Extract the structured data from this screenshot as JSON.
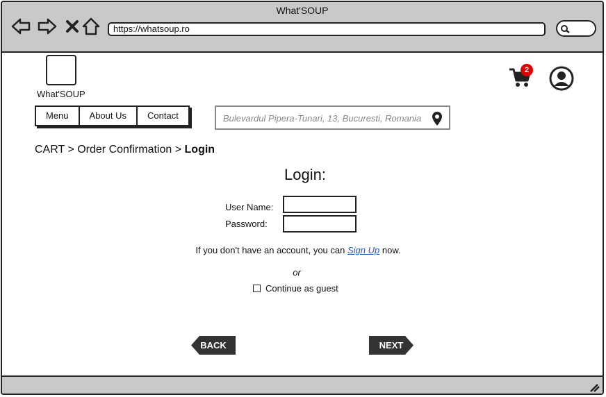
{
  "window": {
    "title": "What'SOUP",
    "url": "https://whatsoup.ro"
  },
  "header": {
    "logo_text": "What'SOUP",
    "cart_count": "2",
    "address": "Bulevardul Pipera-Tunari, 13, Bucuresti, Romania"
  },
  "nav": [
    "Menu",
    "About Us",
    "Contact"
  ],
  "breadcrumb": {
    "items": [
      "CART",
      "Order Confirmation"
    ],
    "separator": ">",
    "current": "Login"
  },
  "login": {
    "title": "Login:",
    "username_label": "User Name:",
    "password_label": "Password:",
    "signup_prefix": "If you don't have an account, you can",
    "signup_link": "Sign Up",
    "signup_suffix": "now.",
    "or_text": "or",
    "guest_label": "Continue as guest"
  },
  "buttons": {
    "back": "BACK",
    "next": "NEXT"
  },
  "colors": {
    "chrome": "#c9c9c9",
    "badge": "#dd0000",
    "link": "#1a5fb4",
    "button": "#333333"
  }
}
